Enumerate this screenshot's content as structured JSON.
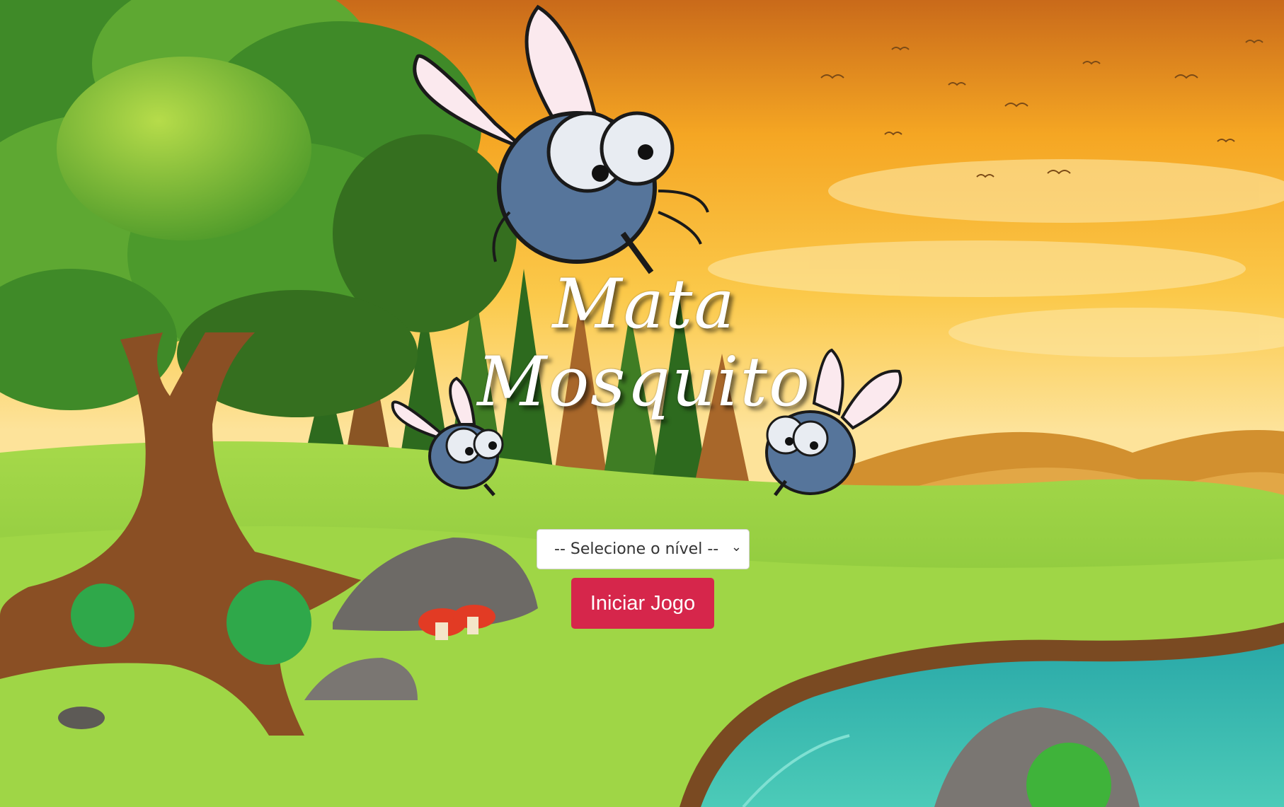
{
  "title": {
    "line1": "Mata",
    "line2": "Mosquito"
  },
  "level_select": {
    "selected": "-- Selecione o nível --",
    "chevron": "chevron-down-icon"
  },
  "start_button": {
    "label": "Iniciar Jogo"
  },
  "colors": {
    "sky_top": "#d9771e",
    "sky_mid": "#f7b52b",
    "sky_low": "#fde08a",
    "grass": "#8fcf3c",
    "water": "#3bbfb0",
    "button": "#d6264b",
    "mosquito_body": "#56759b"
  }
}
